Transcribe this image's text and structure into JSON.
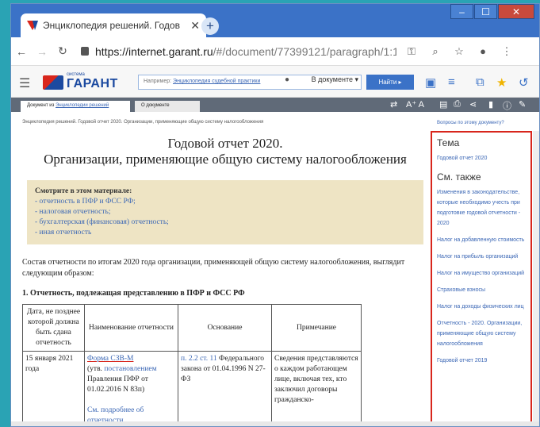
{
  "browser": {
    "tab_title": "Энциклопедия решений. Годов",
    "tab_close": "✕",
    "new_tab": "+",
    "url_host": "https://internet.garant.ru",
    "url_path": "/#/document/77399121/paragraph/1:12",
    "controls": {
      "min": "‒",
      "max": "☐",
      "close": "✕"
    }
  },
  "garant": {
    "logo_small": "система",
    "logo_text": "ГАРАНТ",
    "search_prefix": "Например: ",
    "search_link": "Энциклопедия судебной практики",
    "search_scope": "В документе",
    "find_label": "Найти"
  },
  "docbar": {
    "tab1_prefix": "Документ из ",
    "tab1_link": "Энциклопедии решений",
    "tab2": "О документе",
    "font_size": "A⁺ A"
  },
  "breadcrumb": "Энциклопедия решений. Годовой отчет 2020. Организации, применяющие общую систему налогообложения",
  "side_ask": "Вопросы по этому документу?",
  "doc": {
    "title1": "Годовой отчет 2020.",
    "title2": "Организации, применяющие общую систему налогообложения",
    "box_head": "Смотрите в этом материале:",
    "box_items": [
      "- отчетность в ПФР и ФСС РФ;",
      "- налоговая отчетность;",
      "- бухгалтерская (финансовая) отчетность;",
      "- иная отчетность"
    ],
    "para": "Состав отчетности по итогам 2020 года организации, применяющей общую систему налогообложения, выглядит следующим образом:",
    "section": "1. Отчетность, подлежащая представлению в ПФР и ФСС РФ",
    "table_headers": [
      "Дата, не позднее которой должна быть сдана отчетность",
      "Наименование отчетности",
      "Основание",
      "Примечание"
    ],
    "row1": {
      "date": "15 января 2021 года",
      "form_link": "Форма СЗВ-М",
      "form_rest_a": "(утв. ",
      "form_rest_link": "постановлением",
      "form_rest_b": " Правления ПФР от 01.02.2016 N 83п)",
      "see_more": "См. подробнее об отчетности",
      "basis_link": "п. 2.2 ст. 11",
      "basis_rest": " Федерального закона от 01.04.1996 N 27-ФЗ",
      "note": "Сведения представляются о каждом работающем лице, включая тех, кто заключил договоры гражданско-"
    }
  },
  "sidebar": {
    "theme_head": "Тема",
    "theme_items": [
      "Годовой отчет 2020"
    ],
    "also_head": "См. также",
    "also_items": [
      "Изменения в законодательстве, которые необходимо учесть при подготовке годовой отчетности - 2020",
      "Налог на добавленную стоимость",
      "Налог на прибыль организаций",
      "Налог на имущество организаций",
      "Страховые взносы",
      "Налог на доходы физических лиц",
      "Отчетность - 2020. Организации, применяющие общую систему налогообложения",
      "Годовой отчет 2019"
    ]
  }
}
